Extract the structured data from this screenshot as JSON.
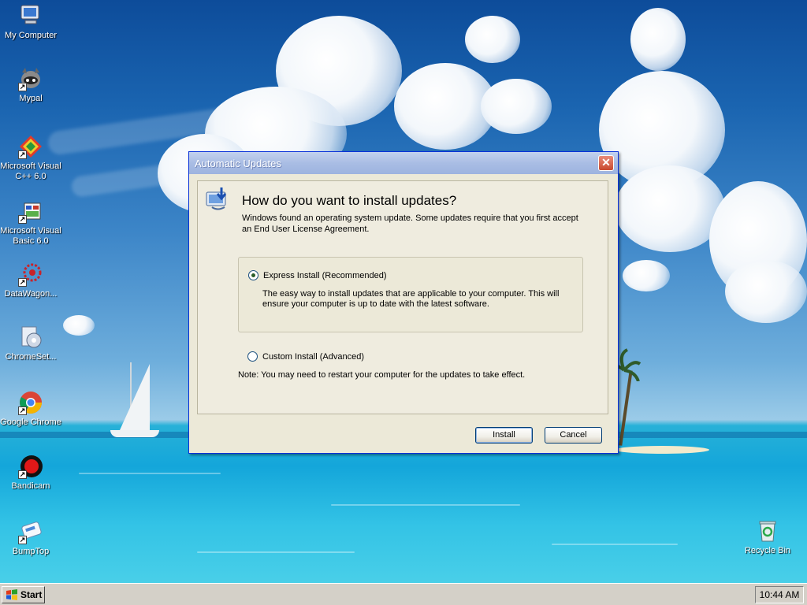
{
  "desktop": {
    "icons": [
      {
        "label": "My Computer",
        "icon": "my-computer-icon"
      },
      {
        "label": "Mypal",
        "icon": "mypal-icon"
      },
      {
        "label": "Microsoft Visual C++ 6.0",
        "icon": "visual-cpp-icon"
      },
      {
        "label": "Microsoft Visual Basic 6.0",
        "icon": "visual-basic-icon"
      },
      {
        "label": "DataWagon...",
        "icon": "datawagon-icon"
      },
      {
        "label": "ChromeSet...",
        "icon": "chromesetup-icon"
      },
      {
        "label": "Google Chrome",
        "icon": "google-chrome-icon"
      },
      {
        "label": "Bandicam",
        "icon": "bandicam-icon"
      },
      {
        "label": "BumpTop",
        "icon": "bumptop-icon"
      }
    ],
    "recycle_bin": {
      "label": "Recycle Bin",
      "icon": "recycle-bin-icon"
    }
  },
  "dialog": {
    "title": "Automatic Updates",
    "heading": "How do you want to install updates?",
    "intro": "Windows found an operating system update. Some updates require that you first accept an End User License Agreement.",
    "express": {
      "label": "Express Install (Recommended)",
      "description": "The easy way to install updates that are applicable to your computer. This will ensure your computer is up to date with the latest software.",
      "selected": true
    },
    "custom": {
      "label": "Custom Install (Advanced)",
      "selected": false
    },
    "note": "Note: You may need to restart your computer for the updates to take effect.",
    "install_label": "Install",
    "cancel_label": "Cancel",
    "close_glyph": "✕"
  },
  "taskbar": {
    "start_label": "Start",
    "clock": "10:44 AM"
  },
  "colors": {
    "title_bar": "#a9bde4",
    "dialog_bg": "#ece9d8",
    "taskbar_bg": "#d4d0c8"
  }
}
